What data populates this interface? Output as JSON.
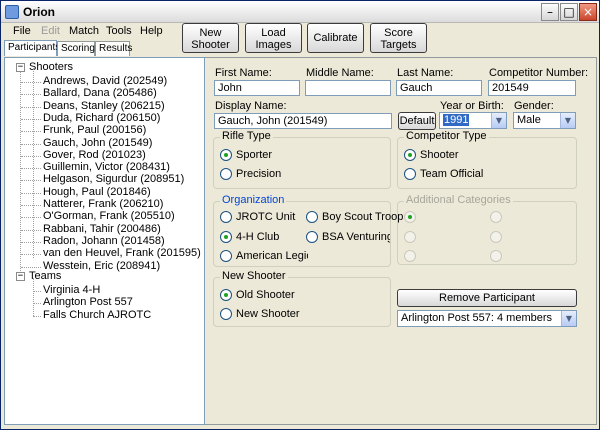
{
  "window": {
    "title": "Orion"
  },
  "menu": [
    {
      "label": "File",
      "enabled": true
    },
    {
      "label": "Edit",
      "enabled": false
    },
    {
      "label": "Match",
      "enabled": true
    },
    {
      "label": "Tools",
      "enabled": true
    },
    {
      "label": "Help",
      "enabled": true
    }
  ],
  "toolbar": {
    "new_shooter": [
      "New",
      "Shooter"
    ],
    "load_images": [
      "Load",
      "Images"
    ],
    "calibrate": "Calibrate",
    "score_targets": [
      "Score",
      "Targets"
    ]
  },
  "tabs": [
    {
      "label": "Participants",
      "active": true
    },
    {
      "label": "Scoring",
      "active": false
    },
    {
      "label": "Results",
      "active": false
    }
  ],
  "tree": {
    "shooters_label": "Shooters",
    "shooters": [
      "Andrews, David (202549)",
      "Ballard, Dana (205486)",
      "Deans, Stanley (206215)",
      "Duda, Richard (206150)",
      "Frunk, Paul (200156)",
      "Gauch, John (201549)",
      "Gover, Rod (201023)",
      "Guillemin, Victor (208431)",
      "Helgason, Sigurdur (208951)",
      "Hough, Paul (201846)",
      "Natterer, Frank (206210)",
      "O'Gorman, Frank (205510)",
      "Rabbani, Tahir (200486)",
      "Radon, Johann (201458)",
      "van den Heuvel, Frank (201595)",
      "Wesstein, Eric (208941)"
    ],
    "teams_label": "Teams",
    "teams": [
      "Virginia 4-H",
      "Arlington Post 557",
      "Falls Church AJROTC"
    ]
  },
  "form": {
    "first_name_label": "First Name:",
    "first_name": "John",
    "middle_name_label": "Middle Name:",
    "middle_name": "",
    "last_name_label": "Last Name:",
    "last_name": "Gauch",
    "competitor_number_label": "Competitor Number:",
    "competitor_number": "201549",
    "display_name_label": "Display Name:",
    "display_name": "Gauch, John (201549)",
    "default_button": "Default",
    "year_label": "Year or Birth:",
    "year": "1991",
    "gender_label": "Gender:",
    "gender": "Male",
    "rifle_type": {
      "title": "Rifle Type",
      "options": [
        {
          "label": "Sporter",
          "checked": true
        },
        {
          "label": "Precision",
          "checked": false
        }
      ]
    },
    "competitor_type": {
      "title": "Competitor Type",
      "options": [
        {
          "label": "Shooter",
          "checked": true
        },
        {
          "label": "Team Official",
          "checked": false
        }
      ]
    },
    "organization": {
      "title": "Organization",
      "options": [
        {
          "label": "JROTC Unit",
          "checked": false
        },
        {
          "label": "Boy Scout Troop",
          "checked": false
        },
        {
          "label": "4-H Club",
          "checked": true
        },
        {
          "label": "BSA Venturing Crew",
          "checked": false
        },
        {
          "label": "American Legion Club",
          "checked": false
        }
      ]
    },
    "additional_categories": {
      "title": "Additional Categories"
    },
    "new_shooter": {
      "title": "New Shooter",
      "options": [
        {
          "label": "Old Shooter",
          "checked": true
        },
        {
          "label": "New Shooter",
          "checked": false
        }
      ]
    },
    "remove_participant_button": "Remove Participant",
    "team_select": "Arlington Post 557: 4 members"
  }
}
